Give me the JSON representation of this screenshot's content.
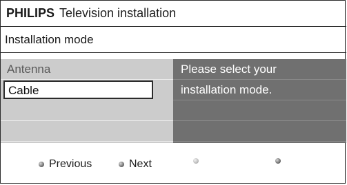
{
  "title_bar": {
    "brand": "PHILIPS",
    "title": "Television installation"
  },
  "header": {
    "label": "Installation mode"
  },
  "menu": {
    "items": [
      {
        "label": "Antenna",
        "selected": false
      },
      {
        "label": "Cable",
        "selected": true
      },
      {
        "label": "",
        "selected": false
      },
      {
        "label": "",
        "selected": false
      }
    ]
  },
  "info": {
    "lines": [
      "Please select your",
      "installation mode."
    ]
  },
  "footer": {
    "items": [
      {
        "label": "Previous",
        "icon": "bullet-icon"
      },
      {
        "label": "Next",
        "icon": "bullet-icon"
      },
      {
        "label": "",
        "icon": "bullet-icon"
      },
      {
        "label": "",
        "icon": "bullet-icon"
      }
    ]
  }
}
